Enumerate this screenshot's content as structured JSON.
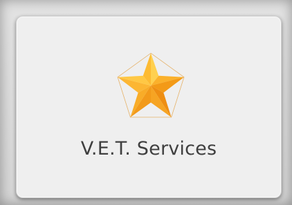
{
  "tile": {
    "label": "V.E.T. Services",
    "icon": "star-icon",
    "colors": {
      "tile_background": "#efefef",
      "label_text": "#3f3f3f",
      "star_light": "#ffc33b",
      "star_dark": "#f08f12"
    }
  }
}
